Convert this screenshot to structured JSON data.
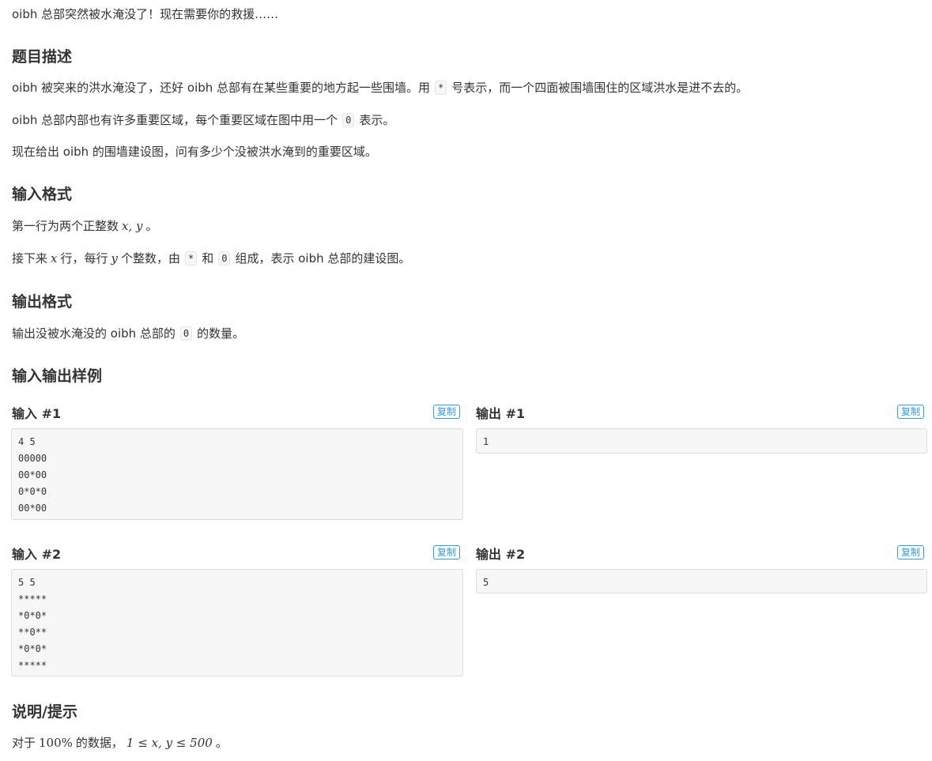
{
  "intro": "oibh 总部突然被水淹没了！现在需要你的救援……",
  "description": {
    "heading": "题目描述",
    "p1_a": "oibh 被突来的洪水淹没了，还好 oibh 总部有在某些重要的地方起一些围墙。用",
    "p1_code": "*",
    "p1_b": "号表示，而一个四面被围墙围住的区域洪水是进不去的。",
    "p2_a": "oibh 总部内部也有许多重要区域，每个重要区域在图中用一个",
    "p2_code": "0",
    "p2_b": "表示。",
    "p3": "现在给出 oibh 的围墙建设图，问有多少个没被洪水淹到的重要区域。"
  },
  "input_format": {
    "heading": "输入格式",
    "p1_a": "第一行为两个正整数",
    "p1_math": "x, y",
    "p1_b": "。",
    "p2_a": "接下来",
    "p2_math_x": "x",
    "p2_b": "行，每行",
    "p2_math_y": "y",
    "p2_c": "个整数，由",
    "p2_code1": "*",
    "p2_d": "和",
    "p2_code2": "0",
    "p2_e": "组成，表示 oibh 总部的建设图。"
  },
  "output_format": {
    "heading": "输出格式",
    "p1_a": "输出没被水淹没的 oibh 总部的",
    "p1_code": "0",
    "p1_b": "的数量。"
  },
  "samples": {
    "heading": "输入输出样例",
    "copy_label": "复制",
    "items": [
      {
        "input_label": "输入 #1",
        "input": "4 5\n00000\n00*00\n0*0*0\n00*00",
        "output_label": "输出 #1",
        "output": "1"
      },
      {
        "input_label": "输入 #2",
        "input": "5 5\n*****\n*0*0*\n**0**\n*0*0*\n*****",
        "output_label": "输出 #2",
        "output": "5"
      }
    ]
  },
  "hint": {
    "heading": "说明/提示",
    "p1_a": "对于",
    "p1_math_pct": "100%",
    "p1_b": "的数据，",
    "p1_math_range": "1 ≤ x, y ≤ 500",
    "p1_c": "。"
  }
}
